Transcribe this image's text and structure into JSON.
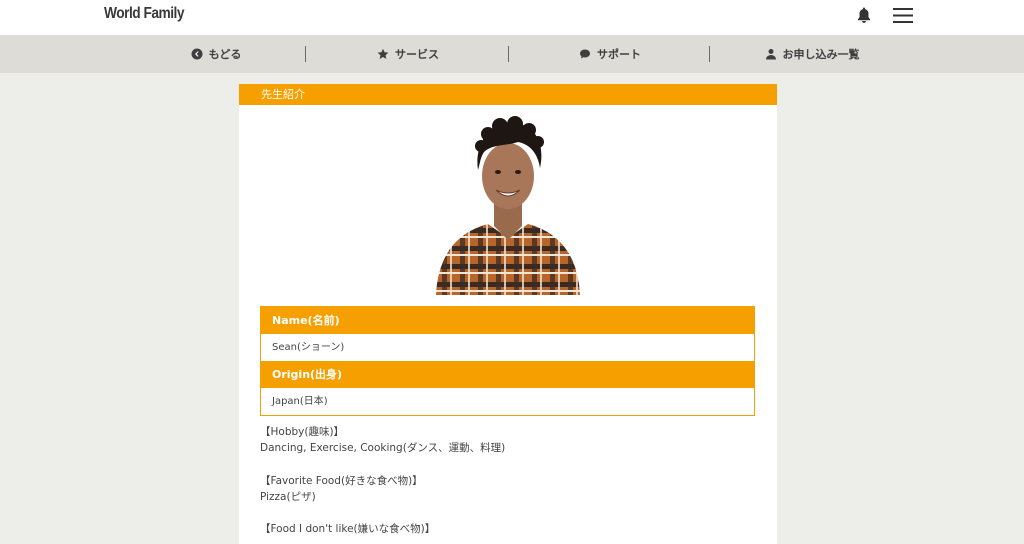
{
  "header": {
    "logo": "World Family",
    "icons": {
      "notification": "bell-icon",
      "menu": "hamburger-menu-icon"
    }
  },
  "nav": {
    "items": [
      {
        "label": "もどる",
        "icon": "back-circle-icon"
      },
      {
        "label": "サービス",
        "icon": "star-icon"
      },
      {
        "label": "サポート",
        "icon": "chat-bubble-icon"
      },
      {
        "label": "お申し込み一覧",
        "icon": "person-icon"
      }
    ]
  },
  "card": {
    "title": "先生紹介",
    "photo": "teacher-portrait",
    "info": [
      {
        "label": "Name(名前)",
        "value": "Sean(ショーン)"
      },
      {
        "label": "Origin(出身)",
        "value": "Japan(日本)"
      }
    ],
    "hobby": {
      "heading": "【Hobby(趣味)】",
      "value": "Dancing, Exercise, Cooking(ダンス、運動、料理)"
    },
    "favorite_food": {
      "heading": "【Favorite Food(好きな食べ物)】",
      "value": "Pizza(ピザ)"
    },
    "disliked_food": {
      "heading": "【Food I don't like(嫌いな食べ物)】"
    }
  },
  "colors": {
    "accent": "#f5a000",
    "page_bg": "#ededea",
    "nav_bg": "#dddcd7"
  }
}
